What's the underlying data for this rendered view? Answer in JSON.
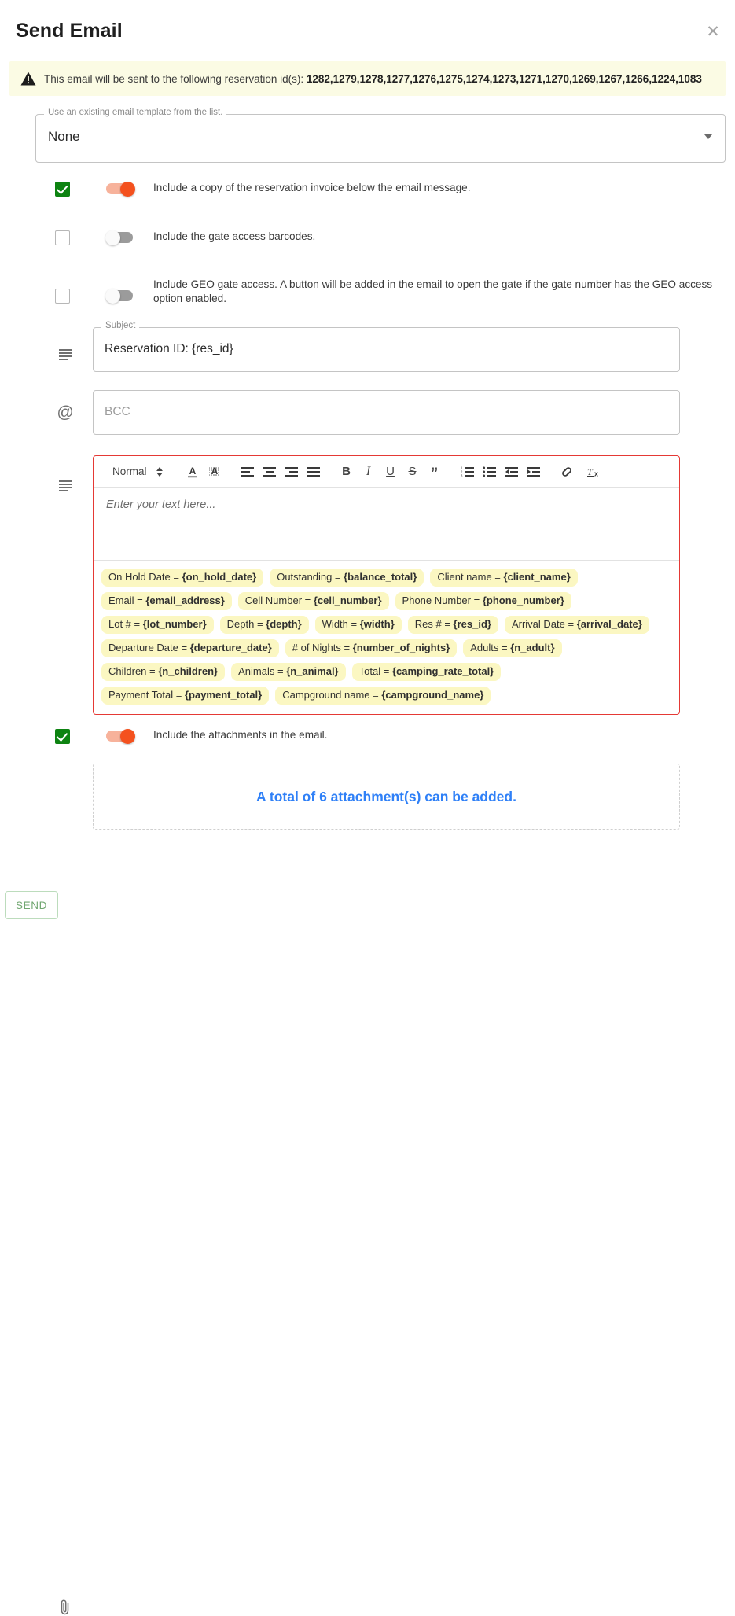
{
  "dialog": {
    "title": "Send Email",
    "close_icon": "close-icon"
  },
  "banner": {
    "icon": "warning-triangle-icon",
    "prefix": "This email will be sent to the following reservation id(s): ",
    "reservation_ids": "1282,1279,1278,1277,1276,1275,1274,1273,1271,1270,1269,1267,1266,1224,1083",
    "background": "#fbfbe4"
  },
  "template_select": {
    "label": "Use an existing email template from the list.",
    "value": "None",
    "arrow_icon": "chevron-down-icon"
  },
  "options": [
    {
      "checked": true,
      "label": "Include a copy of the reservation invoice below the email message."
    },
    {
      "checked": false,
      "label": "Include the gate access barcodes."
    },
    {
      "checked": false,
      "label": "Include GEO gate access. A button will be added in the email to open the gate if the gate number has the GEO access option enabled."
    }
  ],
  "subject": {
    "icon": "subject-lines-icon",
    "label": "Subject",
    "value": "Reservation ID: {res_id}"
  },
  "bcc": {
    "icon": "at-sign-icon",
    "placeholder": "BCC"
  },
  "editor": {
    "icon": "text-body-icon",
    "format_label": "Normal",
    "placeholder": "Enter your text here...",
    "toolbar": [
      {
        "name": "format-select",
        "label": "Normal"
      },
      {
        "name": "font-color-icon",
        "glyph": "A"
      },
      {
        "name": "highlight-color-icon",
        "glyph": "A"
      },
      {
        "name": "align-left-icon",
        "glyph": ""
      },
      {
        "name": "align-center-icon",
        "glyph": ""
      },
      {
        "name": "align-right-icon",
        "glyph": ""
      },
      {
        "name": "align-justify-icon",
        "glyph": ""
      },
      {
        "name": "bold-icon",
        "glyph": "B"
      },
      {
        "name": "italic-icon",
        "glyph": "I"
      },
      {
        "name": "underline-icon",
        "glyph": "U"
      },
      {
        "name": "strikethrough-icon",
        "glyph": "S"
      },
      {
        "name": "blockquote-icon",
        "glyph": "”"
      },
      {
        "name": "ordered-list-icon",
        "glyph": ""
      },
      {
        "name": "bullet-list-icon",
        "glyph": ""
      },
      {
        "name": "outdent-icon",
        "glyph": ""
      },
      {
        "name": "indent-icon",
        "glyph": ""
      },
      {
        "name": "link-icon",
        "glyph": ""
      },
      {
        "name": "clear-format-icon",
        "glyph": "Tx"
      }
    ],
    "border_color": "#e53935"
  },
  "merge_tags": [
    {
      "label": "On Hold Date = ",
      "token": "{on_hold_date}"
    },
    {
      "label": "Outstanding = ",
      "token": "{balance_total}"
    },
    {
      "label": "Client name = ",
      "token": "{client_name}"
    },
    {
      "label": "Email = ",
      "token": "{email_address}"
    },
    {
      "label": "Cell Number = ",
      "token": "{cell_number}"
    },
    {
      "label": "Phone Number = ",
      "token": "{phone_number}"
    },
    {
      "label": "Lot # = ",
      "token": "{lot_number}"
    },
    {
      "label": "Depth = ",
      "token": "{depth}"
    },
    {
      "label": "Width = ",
      "token": "{width}"
    },
    {
      "label": "Res # = ",
      "token": "{res_id}"
    },
    {
      "label": "Arrival Date = ",
      "token": "{arrival_date}"
    },
    {
      "label": "Departure Date = ",
      "token": "{departure_date}"
    },
    {
      "label": "# of Nights = ",
      "token": "{number_of_nights}"
    },
    {
      "label": "Adults = ",
      "token": "{n_adult}"
    },
    {
      "label": "Children = ",
      "token": "{n_children}"
    },
    {
      "label": "Animals = ",
      "token": "{n_animal}"
    },
    {
      "label": "Total = ",
      "token": "{camping_rate_total}"
    },
    {
      "label": "Payment Total = ",
      "token": "{payment_total}"
    },
    {
      "label": "Campground name = ",
      "token": "{campground_name}"
    }
  ],
  "attachments_option": {
    "checked": true,
    "label": "Include the attachments in the email."
  },
  "dropzone": {
    "icon": "paperclip-icon",
    "text": "A total of 6 attachment(s) can be added.",
    "text_color": "#2f80f7"
  },
  "footer": {
    "send_label": "SEND"
  },
  "colors": {
    "toggle_on": "#f4511e",
    "toggle_on_track": "#f7b29b",
    "checkbox_on": "#0d8311",
    "tag_bg": "#fbf7c2",
    "banner_bg": "#fbfbe4",
    "link_blue": "#2f80f7"
  }
}
